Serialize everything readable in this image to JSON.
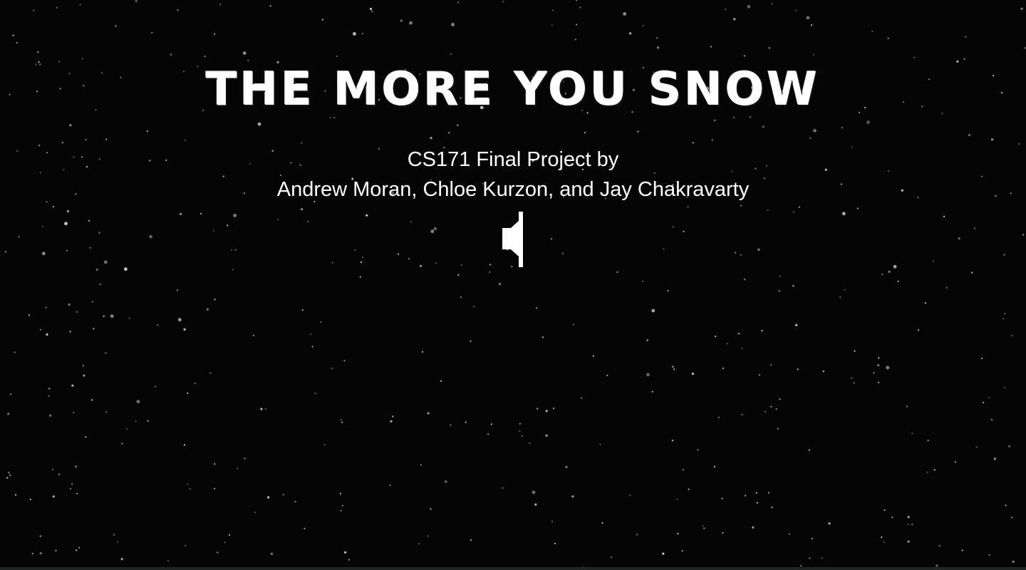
{
  "page": {
    "title": "THE MORE YOU SNOW",
    "subtitle_line1": "CS171 Final Project by",
    "subtitle_line2": "Andrew Moran, Chloe Kurzon, and Jay Chakravarty"
  },
  "controls": {
    "sound_icon": "speaker-icon"
  },
  "colors": {
    "background": "#050505",
    "text": "#ffffff",
    "snow": "#cfcfcf"
  }
}
